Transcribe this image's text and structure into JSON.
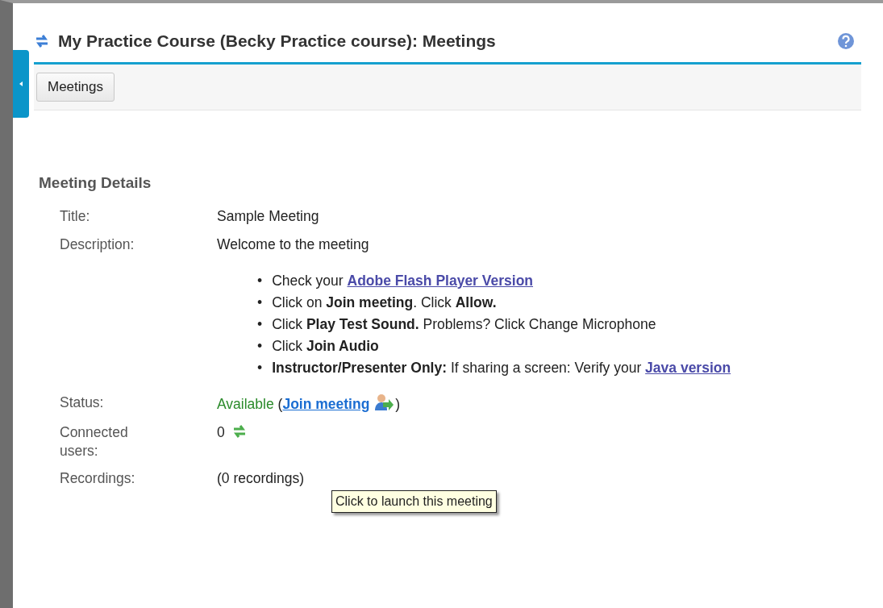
{
  "header": {
    "title": "My Practice Course (Becky Practice course): Meetings"
  },
  "toolbar": {
    "buttons": [
      "Meetings"
    ]
  },
  "section": {
    "title": "Meeting Details"
  },
  "details": {
    "title_label": "Title:",
    "title_value": "Sample Meeting",
    "description_label": "Description:",
    "description_value": "Welcome to the meeting",
    "bullets": [
      {
        "marker": "•",
        "text": "Check your ",
        "link": "Adobe Flash Player Version"
      },
      {
        "marker": "•",
        "text": "Click on **Join meeting**. Click **Allow.**"
      },
      {
        "marker": "•",
        "text": "Click **Play Test Sound.**  Problems? Click Change Microphone"
      },
      {
        "marker": "•",
        "text": "Click **Join Audio**"
      },
      {
        "marker": "•",
        "text": "**Instructor/Presenter Only:** If  sharing a screen: Verify your ",
        "link": "Java version"
      }
    ],
    "status_label": "Status:",
    "status_value": "Available",
    "status_open": "(",
    "join_link": "Join meeting",
    "status_close": ")",
    "tooltip": "Click to launch this meeting",
    "users_label": "Connected users:",
    "users_value": "0",
    "recordings_label": "Recordings:",
    "recordings_value": "(0 recordings)"
  }
}
